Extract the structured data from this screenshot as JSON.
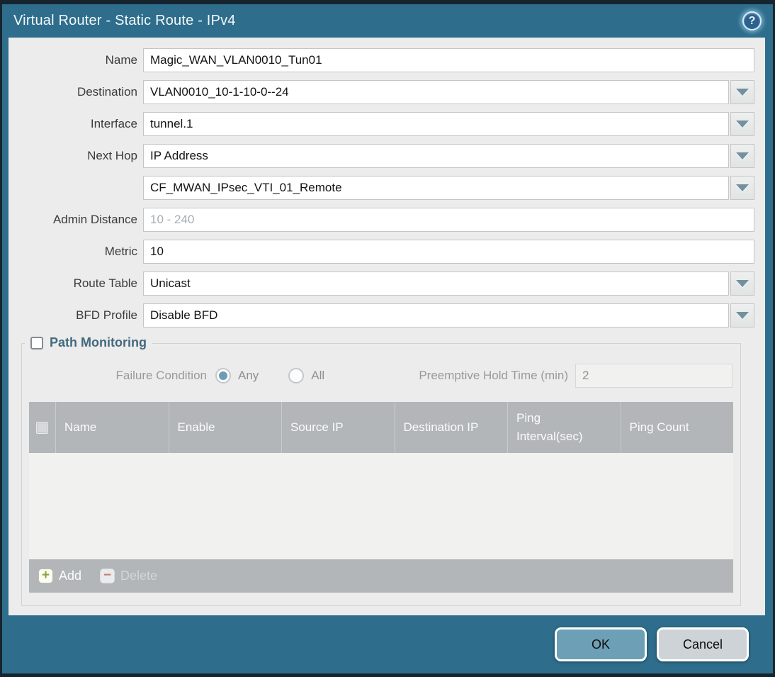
{
  "window": {
    "title": "Virtual Router - Static Route - IPv4"
  },
  "colors": {
    "teal_frame": "#2e6e8c",
    "navy_border": "#16242f",
    "content_bg": "#ececec",
    "table_header_bg": "#b2b6b9",
    "ok_button_bg": "#6da0b6",
    "cancel_button_bg": "#ced3d7",
    "radio_selected": "#6d9cb4",
    "add_icon_green": "#8ba33d",
    "delete_icon_red": "#cb7a74",
    "legend_text": "#44697e"
  },
  "fields": {
    "name": {
      "label": "Name",
      "value": "Magic_WAN_VLAN0010_Tun01"
    },
    "destination": {
      "label": "Destination",
      "value": "VLAN0010_10-1-10-0--24"
    },
    "interface": {
      "label": "Interface",
      "value": "tunnel.1"
    },
    "next_hop": {
      "label": "Next Hop",
      "value": "IP Address"
    },
    "next_hop_address": {
      "value": "CF_MWAN_IPsec_VTI_01_Remote"
    },
    "admin_distance": {
      "label": "Admin Distance",
      "placeholder": "10 - 240"
    },
    "metric": {
      "label": "Metric",
      "value": "10"
    },
    "route_table": {
      "label": "Route Table",
      "value": "Unicast"
    },
    "bfd_profile": {
      "label": "BFD Profile",
      "value": "Disable BFD"
    }
  },
  "path_monitoring": {
    "title": "Path Monitoring",
    "enabled": false,
    "failure_condition": {
      "label": "Failure Condition",
      "options": [
        {
          "label": "Any",
          "selected": true
        },
        {
          "label": "All",
          "selected": false
        }
      ]
    },
    "preemptive_hold": {
      "label": "Preemptive Hold Time (min)",
      "value": "2"
    },
    "table": {
      "columns": [
        "Name",
        "Enable",
        "Source IP",
        "Destination IP",
        "Ping Interval(sec)",
        "Ping Count"
      ],
      "rows": []
    },
    "toolbar": {
      "add_label": "Add",
      "delete_label": "Delete"
    }
  },
  "footer": {
    "ok_label": "OK",
    "cancel_label": "Cancel"
  }
}
